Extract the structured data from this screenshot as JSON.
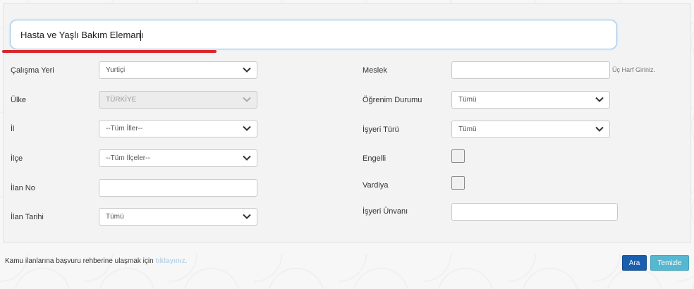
{
  "search": {
    "value": "Hasta ve Yaşlı Bakım Elemanı"
  },
  "left_fields": {
    "calisma_yeri": {
      "label": "Çalışma Yeri",
      "value": "Yurtiçi"
    },
    "ulke": {
      "label": "Ülke",
      "value": "TÜRKİYE"
    },
    "il": {
      "label": "İl",
      "value": "--Tüm İller--"
    },
    "ilce": {
      "label": "İlçe",
      "value": "--Tüm İlçeler--"
    },
    "ilan_no": {
      "label": "İlan No",
      "value": ""
    },
    "ilan_tarihi": {
      "label": "İlan Tarihi",
      "value": "Tümü"
    }
  },
  "right_fields": {
    "meslek": {
      "label": "Meslek",
      "value": "",
      "hint": "Üç Harf Giriniz."
    },
    "ogrenim_durumu": {
      "label": "Öğrenim Durumu",
      "value": "Tümü"
    },
    "isyeri_turu": {
      "label": "İşyeri Türü",
      "value": "Tümü"
    },
    "engelli": {
      "label": "Engelli",
      "checked": false
    },
    "vardiya": {
      "label": "Vardiya",
      "checked": false
    },
    "isyeri_unvani": {
      "label": "İşyeri Ünvanı",
      "value": ""
    }
  },
  "footer": {
    "text": "Kamu ilanlarına başvuru rehberine ulaşmak için ",
    "link": "tıklayınız."
  },
  "buttons": {
    "search": "Ara",
    "clear": "Temizle"
  },
  "colors": {
    "highlight_underline": "#d9262a",
    "primary_button": "#1a5fae",
    "secondary_button": "#56b7d0"
  },
  "icons": {
    "dropdown": "chevron-down-icon"
  }
}
